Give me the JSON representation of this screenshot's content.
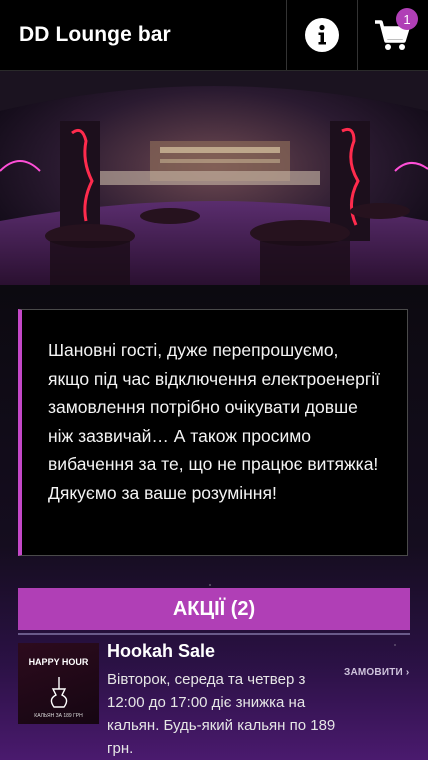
{
  "header": {
    "title": "DD Lounge bar",
    "cart_count": "1"
  },
  "notice": {
    "text": "Шановні гості, дуже перепрошуємо, якщо під час відключення електроенергії замовлення потрібно очікувати довше ніж зазвичай… А також просимо вибачення за те, що не працює витяжка! Дякуємо за ваше розуміння!"
  },
  "section": {
    "title": "АКЦІЇ (2)"
  },
  "product": {
    "name": "Hookah Sale",
    "description": "Вівторок, середа та четвер з 12:00 до 17:00 діє знижка на кальян. Будь-який кальян по 189 грн.",
    "order_label": "ЗАМОВИТИ",
    "image_title": "HAPPY HOUR",
    "image_caption": "КАЛЬЯН ЗА 189 ГРН"
  },
  "colors": {
    "accent": "#b03fb6",
    "notice_border": "#c548c8"
  },
  "icons": {
    "info": "info-icon",
    "cart": "cart-icon",
    "order_arrow": "chevron-right-icon"
  }
}
